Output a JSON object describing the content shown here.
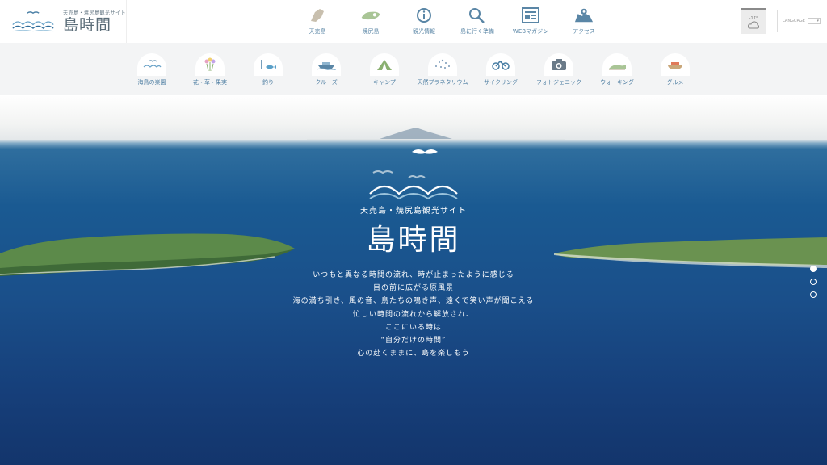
{
  "site": {
    "subtitle": "天売島・焼尻島観光サイト",
    "title": "島時間"
  },
  "topnav": [
    {
      "label": "天売島",
      "icon": "teuri-island-icon"
    },
    {
      "label": "焼尻島",
      "icon": "yagishiri-island-icon"
    },
    {
      "label": "観光情報",
      "icon": "info-icon"
    },
    {
      "label": "島に行く準備",
      "icon": "search-icon"
    },
    {
      "label": "WEBマガジン",
      "icon": "magazine-icon"
    },
    {
      "label": "アクセス",
      "icon": "map-icon"
    }
  ],
  "weather": {
    "temp": "-17°"
  },
  "language": {
    "label": "LANGUAGE",
    "value": "▾"
  },
  "categories": [
    {
      "label": "海鳥の楽園",
      "icon": "seabird-icon"
    },
    {
      "label": "花・草・果実",
      "icon": "flower-icon"
    },
    {
      "label": "釣り",
      "icon": "fishing-icon"
    },
    {
      "label": "クルーズ",
      "icon": "cruise-icon"
    },
    {
      "label": "キャンプ",
      "icon": "camp-icon"
    },
    {
      "label": "天然プラネタリウム",
      "icon": "stars-icon"
    },
    {
      "label": "サイクリング",
      "icon": "bicycle-icon"
    },
    {
      "label": "フォトジェニック",
      "icon": "camera-icon"
    },
    {
      "label": "ウォーキング",
      "icon": "walking-icon"
    },
    {
      "label": "グルメ",
      "icon": "gourmet-icon"
    }
  ],
  "hero": {
    "subtitle": "天売島・焼尻島観光サイト",
    "title": "島時間",
    "poem": [
      "いつもと異なる時間の流れ、時が止まったように感じる",
      "目の前に広がる原風景",
      "海の満ち引き、風の音、鳥たちの鳴き声、遠くで笑い声が聞こえる",
      "忙しい時間の流れから解放され、",
      "ここにいる時は",
      "“自分だけの時間”",
      "心の赴くままに、島を楽しもう"
    ]
  },
  "slider": {
    "count": 3,
    "active": 1
  },
  "colors": {
    "accent": "#5a86a6",
    "sea": "#1a5a92"
  }
}
